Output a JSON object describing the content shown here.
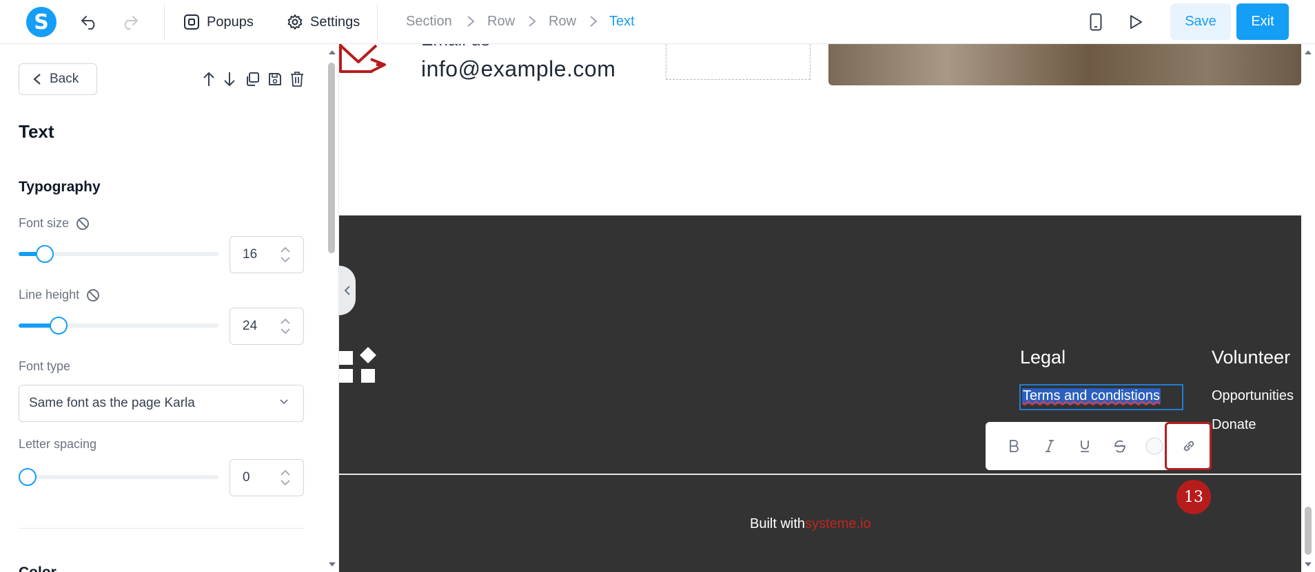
{
  "topbar": {
    "logo_letter": "S",
    "popups_label": "Popups",
    "settings_label": "Settings",
    "breadcrumb": [
      "Section",
      "Row",
      "Row",
      "Text"
    ],
    "save_label": "Save",
    "exit_label": "Exit"
  },
  "sidebar": {
    "back_label": "Back",
    "panel_title": "Text",
    "typography_title": "Typography",
    "font_size": {
      "label": "Font size",
      "value": "16",
      "level": 0.13
    },
    "line_height": {
      "label": "Line height",
      "value": "24",
      "level": 0.2
    },
    "font_type": {
      "label": "Font type",
      "value": "Same font as the page Karla"
    },
    "letter_spacing": {
      "label": "Letter spacing",
      "value": "0",
      "level": 0.0
    },
    "next_section_title": "Color"
  },
  "canvas": {
    "email_label": "Email us",
    "email_value": "info@example.com",
    "legal_heading": "Legal",
    "volunteer_heading": "Volunteer",
    "selected_link_text": "Terms and condistions",
    "volunteer_links": [
      "Opportunities",
      "Donate"
    ],
    "built_prefix": "Built with",
    "built_brand": "systeme.io",
    "annotation_number": "13"
  },
  "colors": {
    "accent": "#149ef5",
    "footer_bg": "#333333",
    "highlight": "#b71c1c"
  }
}
